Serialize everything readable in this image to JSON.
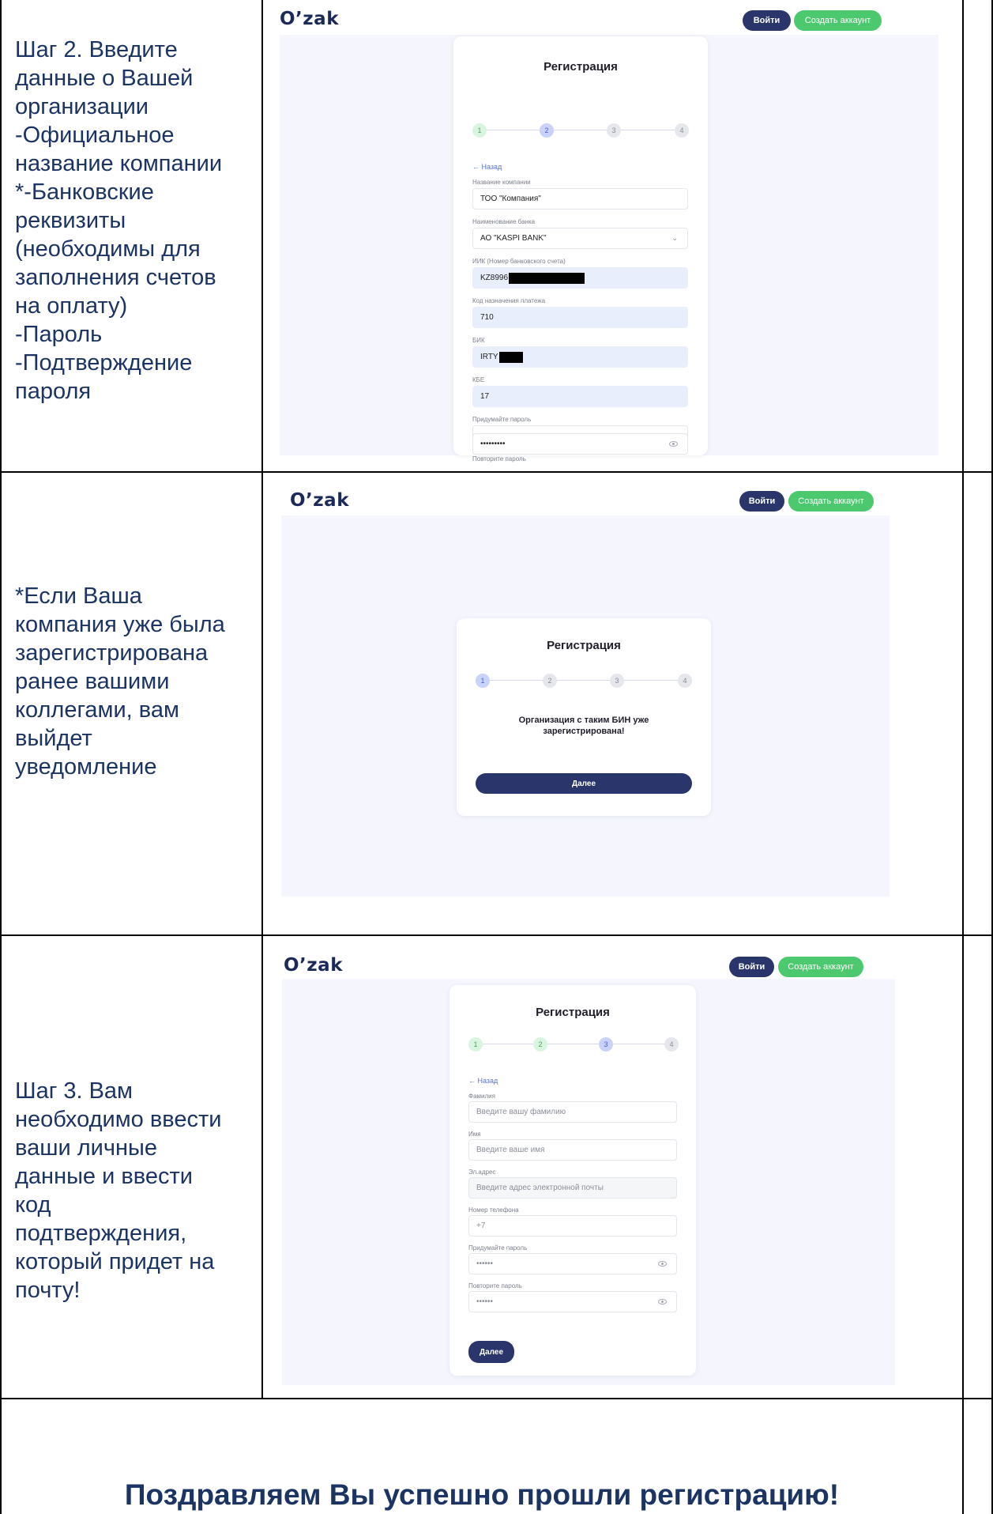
{
  "rows": [
    {
      "instruction": [
        "Шаг 2. Введите",
        "данные о Вашей",
        "организации",
        "-Официальное",
        "название компании",
        "*-Банковские",
        "реквизиты",
        "(необходимы для",
        "заполнения счетов",
        "на оплату)",
        "-Пароль",
        "-Подтверждение",
        "пароля"
      ],
      "screen": {
        "logo": "O’zak",
        "login_label": "Войти",
        "signup_label": "Создать аккаунт",
        "title": "Регистрация",
        "steps": [
          "1",
          "2",
          "3",
          "4"
        ],
        "back": "← Назад",
        "fields": [
          {
            "label": "Название компании",
            "value": "ТОО \"Компания\""
          },
          {
            "label": "Наименование банка",
            "value": "АО \"KASPI BANK\""
          },
          {
            "label": "ИИК (Номер банковского счета)",
            "value": "KZ8996"
          },
          {
            "label": "Код назначения платежа",
            "value": "710"
          },
          {
            "label": "БИК",
            "value": "IRTY"
          },
          {
            "label": "КБЕ",
            "value": "17"
          },
          {
            "label": "Придумайте пароль",
            "value": "•••••••••"
          },
          {
            "label": "Повторите пароль",
            "value": "•••••••••"
          }
        ]
      }
    },
    {
      "instruction": [
        "*Если Ваша",
        "компания уже была",
        "зарегистрирована",
        "ранее вашими",
        "коллегами, вам",
        "выйдет",
        "уведомление"
      ],
      "screen": {
        "logo": "O’zak",
        "login_label": "Войти",
        "signup_label": "Создать аккаунт",
        "title": "Регистрация",
        "steps": [
          "1",
          "2",
          "3",
          "4"
        ],
        "notice": [
          "Организация с таким БИН уже",
          "зарегистрирована!"
        ],
        "next_label": "Далее"
      }
    },
    {
      "instruction": [
        "Шаг 3. Вам",
        "необходимо ввести",
        "ваши личные",
        "данные и ввести",
        "код",
        "подтверждения,",
        "который придет на",
        "почту!"
      ],
      "screen": {
        "logo": "O’zak",
        "login_label": "Войти",
        "signup_label": "Создать аккаунт",
        "title": "Регистрация",
        "steps": [
          "1",
          "2",
          "3",
          "4"
        ],
        "back": "← Назад",
        "fields": [
          {
            "label": "Фамилия",
            "placeholder": "Введите вашу фамилию"
          },
          {
            "label": "Имя",
            "placeholder": "Введите ваше имя"
          },
          {
            "label": "Эл.адрес",
            "placeholder": "Введите адрес электронной почты"
          },
          {
            "label": "Номер телефона",
            "placeholder": "+7"
          },
          {
            "label": "Придумайте пароль",
            "placeholder": "••••••"
          },
          {
            "label": "Повторите пароль",
            "placeholder": "••••••"
          }
        ],
        "next_label": "Далее"
      }
    }
  ],
  "final_message": "Поздравляем Вы успешно прошли регистрацию!",
  "colors": {
    "text_accent": "#1c3463",
    "brand_dark": "#2a356b",
    "brand_green": "#4cc96f",
    "page_bg": "#f4f5fd"
  }
}
